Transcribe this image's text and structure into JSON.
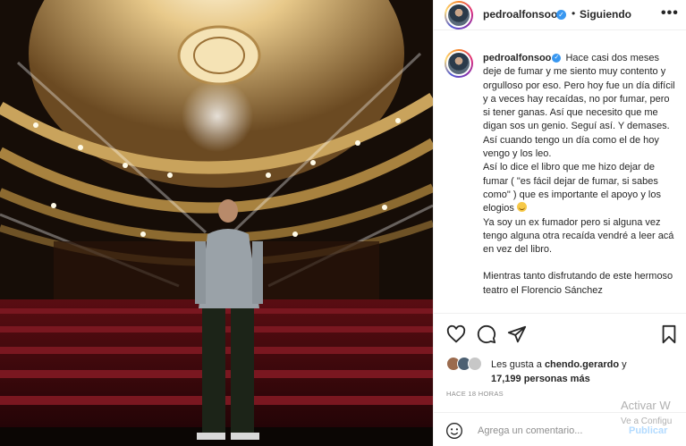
{
  "post": {
    "username": "pedroalfonsoo",
    "follow_status": "Siguiendo",
    "separator": "•",
    "more": "•••",
    "verified_mark": "✓"
  },
  "caption": {
    "username": "pedroalfonsoo",
    "lines": [
      "Hace casi dos meses deje de fumar y me siento muy contento y orgulloso por eso. Pero hoy fue un día difícil y a veces hay recaídas, no por fumar, pero si tener ganas. Así que necesito que me digan sos un genio. Seguí así. Y demases. Así cuando tengo un día como el de hoy vengo y los leo.",
      "Así lo dice el libro que me hizo dejar de fumar ( \"es fácil dejar de fumar, si sabes como\" ) que es importante el apoyo y los elogios",
      "Ya soy un ex fumador pero si alguna vez tengo alguna otra recaída vendré a leer acá en vez del libro.",
      "Mientras tanto disfrutando de este hermoso teatro el Florencio Sánchez"
    ]
  },
  "icons": {
    "like": "heart-icon",
    "comment": "comment-icon",
    "share": "paper-plane-icon",
    "save": "bookmark-icon",
    "emoji": "smiley-icon"
  },
  "likes": {
    "prefix": "Les gusta a",
    "user": "chendo.gerardo",
    "conj": "y",
    "count": "17,199 personas más"
  },
  "timestamp": "HACE 18 HORAS",
  "comment_box": {
    "placeholder": "Agrega un comentario...",
    "publish": "Publicar"
  },
  "overlay": {
    "line1": "Activar W",
    "line2": "Ve a Configu"
  },
  "colors": {
    "verified": "#3897f0",
    "publish_disabled": "#b3dbff",
    "muted": "#8e8e8e"
  }
}
